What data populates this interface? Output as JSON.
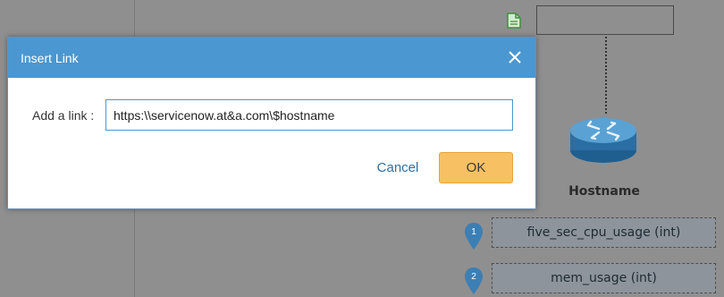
{
  "background": {
    "node_label": "Hostname",
    "metrics": [
      {
        "badge": "1",
        "label": "five_sec_cpu_usage (int)"
      },
      {
        "badge": "2",
        "label": "mem_usage (int)"
      }
    ],
    "icons": {
      "document": "document-icon",
      "router": "router-icon",
      "pin": "map-pin-icon"
    },
    "colors": {
      "overlay": "#8f8f8f",
      "pin": "#3c7fb5",
      "router": "#2f78b0"
    }
  },
  "dialog": {
    "title": "Insert Link",
    "close_icon": "close-icon",
    "field_label": "Add a link :",
    "link_value": "https:\\\\servicenow.at&a.com\\$hostname",
    "cancel_label": "Cancel",
    "ok_label": "OK",
    "colors": {
      "header": "#4a97d1",
      "ok": "#f7c163",
      "cancel_text": "#2d6fa3"
    }
  }
}
